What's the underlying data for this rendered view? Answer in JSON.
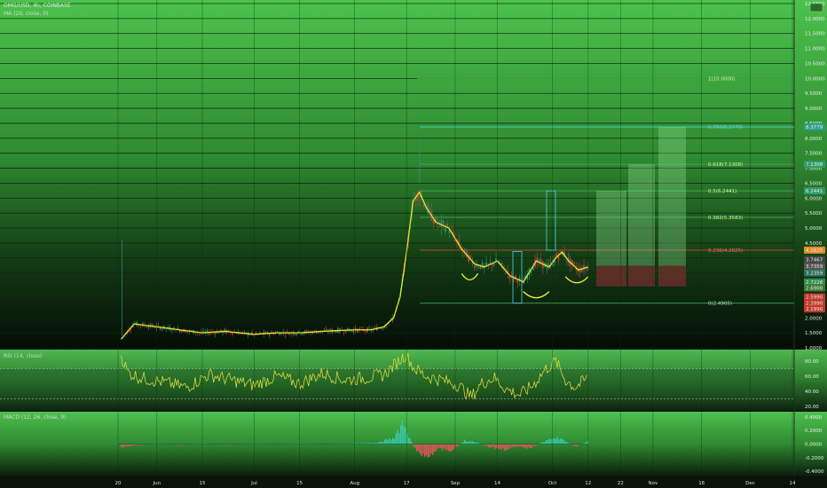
{
  "header": {
    "symbol": "OMG/USD, 4h, COINBASE",
    "ma": "MA (20, close, 0)",
    "rsi": "RSI (14, close)",
    "macd": "MACD (12, 26, close, 9)"
  },
  "colors": {
    "candle_up": "#2e8f7e",
    "candle_down": "#c2453f",
    "ma": "#e6e62a",
    "rsi": "#d8d83c",
    "fib_line": "#3fb25a",
    "fib_red": "#e0433a",
    "rect_blue": "#4fd6e8"
  },
  "chart_data": [
    {
      "type": "line",
      "pane": "price",
      "title": "OMG/USD, 4h, COINBASE",
      "ylim": [
        1.0,
        12.5
      ],
      "yticks": [
        "12.5000",
        "12.0000",
        "11.5000",
        "11.0000",
        "10.5000",
        "10.0000",
        "9.5000",
        "9.0000",
        "8.5000",
        "8.0000",
        "7.5000",
        "7.0000",
        "6.5000",
        "6.0000",
        "5.5000",
        "5.0000",
        "4.5000",
        "4.0000",
        "3.5000",
        "3.0000",
        "2.5000",
        "2.0000",
        "1.5000",
        "1.0000"
      ],
      "xticks": [
        "20",
        "Jun",
        "15",
        "Jul",
        "15",
        "Aug",
        "17",
        "Sep",
        "14",
        "Oct",
        "12",
        "22",
        "Nov",
        "16",
        "Dec",
        "14"
      ],
      "x_dates": [
        "May 20",
        "Jun",
        "Jun 15",
        "Jul",
        "Jul 15",
        "Aug",
        "Aug 17",
        "Sep",
        "Sep 14",
        "Oct",
        "Oct 12",
        "Oct 22",
        "Nov",
        "Nov 16",
        "Dec",
        "Dec 14"
      ],
      "series": [
        {
          "name": "MA (20, close, 0)",
          "x": [
            "May 21",
            "May 25",
            "Jun 1",
            "Jun 8",
            "Jun 15",
            "Jun 22",
            "Jul 1",
            "Jul 8",
            "Jul 15",
            "Jul 22",
            "Aug 1",
            "Aug 6",
            "Aug 10",
            "Aug 13",
            "Aug 15",
            "Aug 17",
            "Aug 19",
            "Aug 21",
            "Aug 23",
            "Aug 26",
            "Aug 30",
            "Sep 3",
            "Sep 7",
            "Sep 10",
            "Sep 14",
            "Sep 18",
            "Sep 22",
            "Sep 26",
            "Sep 30",
            "Oct 2",
            "Oct 4",
            "Oct 6",
            "Oct 9",
            "Oct 12"
          ],
          "values": [
            1.3,
            1.8,
            1.7,
            1.6,
            1.5,
            1.55,
            1.45,
            1.5,
            1.5,
            1.55,
            1.6,
            1.6,
            1.7,
            2.0,
            2.7,
            4.2,
            5.9,
            6.2,
            5.7,
            5.2,
            5.0,
            4.3,
            3.8,
            3.7,
            3.9,
            3.4,
            3.2,
            3.9,
            3.7,
            4.0,
            4.2,
            3.9,
            3.6,
            3.7
          ]
        }
      ],
      "fib_levels": [
        {
          "label": "1(10.0000)",
          "value": 10.0
        },
        {
          "label": "0.786(8.3779)",
          "value": 8.3779
        },
        {
          "label": "0.618(7.1308)",
          "value": 7.1308
        },
        {
          "label": "0.5(6.2441)",
          "value": 6.2441
        },
        {
          "label": "0.382(5.3583)",
          "value": 5.3583
        },
        {
          "label": "0.236(4.2625)",
          "value": 4.2625
        },
        {
          "label": "0(2.4905)",
          "value": 2.4905
        }
      ],
      "price_labels": [
        "8.3779",
        "7.1308",
        "6.2441",
        "4.2625",
        "3.7467",
        "3.7359",
        "3.2359",
        "2.7228",
        "2.6900",
        "2.5990",
        "2.3990",
        "2.1990"
      ]
    },
    {
      "type": "line",
      "pane": "rsi",
      "title": "RSI (14, close)",
      "ylim": [
        15,
        92
      ],
      "yticks": [
        "80.00",
        "60.00",
        "40.00",
        "20.00"
      ],
      "bands": [
        70,
        30
      ],
      "series": [
        {
          "name": "RSI (14, close)",
          "x": [
            "May 21",
            "May 23",
            "May 27",
            "Jun 3",
            "Jun 10",
            "Jun 17",
            "Jun 24",
            "Jul 1",
            "Jul 8",
            "Jul 15",
            "Jul 22",
            "Jul 29",
            "Aug 5",
            "Aug 10",
            "Aug 14",
            "Aug 17",
            "Aug 19",
            "Aug 23",
            "Aug 28",
            "Sep 2",
            "Sep 6",
            "Sep 9",
            "Sep 13",
            "Sep 17",
            "Sep 21",
            "Sep 25",
            "Sep 29",
            "Oct 2",
            "Oct 5",
            "Oct 8",
            "Oct 12"
          ],
          "values": [
            88,
            65,
            58,
            52,
            45,
            62,
            55,
            48,
            60,
            50,
            64,
            55,
            58,
            62,
            78,
            90,
            72,
            60,
            55,
            48,
            32,
            50,
            58,
            42,
            35,
            48,
            70,
            80,
            55,
            45,
            58
          ]
        }
      ]
    },
    {
      "type": "bar",
      "pane": "macd",
      "title": "MACD (12, 26, close, 9)",
      "ylim": [
        -0.45,
        0.45
      ],
      "yticks": [
        "0.4000",
        "0.2000",
        "0.0000",
        "-0.2000",
        "-0.4000"
      ],
      "x": [
        "May 21",
        "May 25",
        "Jun 1",
        "Jun 8",
        "Jun 15",
        "Jun 22",
        "Jul 1",
        "Jul 8",
        "Jul 15",
        "Jul 22",
        "Aug 1",
        "Aug 8",
        "Aug 13",
        "Aug 16",
        "Aug 18",
        "Aug 20",
        "Aug 23",
        "Aug 27",
        "Aug 31",
        "Sep 4",
        "Sep 8",
        "Sep 12",
        "Sep 16",
        "Sep 20",
        "Sep 24",
        "Sep 28",
        "Oct 2",
        "Oct 5",
        "Oct 8",
        "Oct 12"
      ],
      "values": [
        -0.05,
        -0.02,
        0.01,
        -0.01,
        0.01,
        -0.01,
        0.01,
        0.0,
        0.01,
        0.0,
        0.01,
        0.02,
        0.1,
        0.38,
        0.1,
        -0.12,
        -0.2,
        -0.08,
        -0.1,
        0.06,
        0.02,
        -0.05,
        -0.08,
        -0.04,
        -0.06,
        0.03,
        0.12,
        0.04,
        -0.04,
        0.05
      ]
    }
  ]
}
